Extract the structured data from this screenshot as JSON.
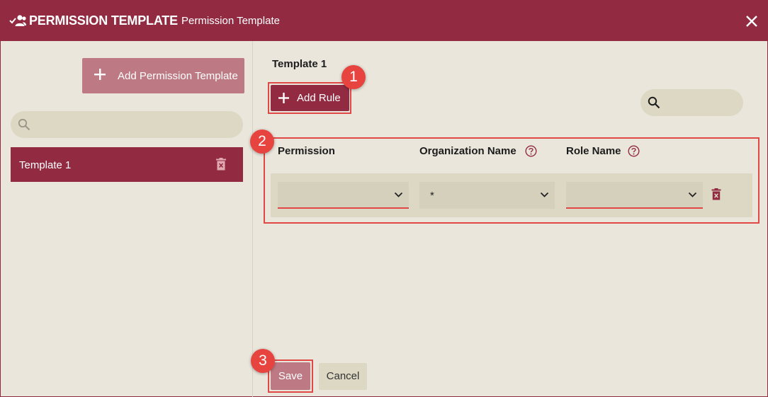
{
  "header": {
    "title": "PERMISSION TEMPLATE",
    "subtitle": "Permission Template",
    "icon": "people-check-icon",
    "close_icon": "close-icon"
  },
  "sidebar": {
    "add_button_label": "Add Permission Template",
    "search_placeholder": "",
    "templates": [
      {
        "label": "Template 1",
        "selected": true
      }
    ]
  },
  "main": {
    "template_title": "Template 1",
    "add_rule_label": "Add Rule",
    "search_placeholder": "",
    "columns": {
      "permission": "Permission",
      "organization": "Organization Name",
      "role": "Role Name"
    },
    "rules": [
      {
        "permission": "",
        "organization": "*",
        "role": ""
      }
    ]
  },
  "footer": {
    "save_label": "Save",
    "cancel_label": "Cancel"
  },
  "annotations": {
    "step1": "1",
    "step2": "2",
    "step3": "3"
  },
  "colors": {
    "brand": "#922b42",
    "brand_light": "#be7a84",
    "background": "#eae6dc",
    "field": "#dcd8c4",
    "highlight": "#e04848"
  }
}
